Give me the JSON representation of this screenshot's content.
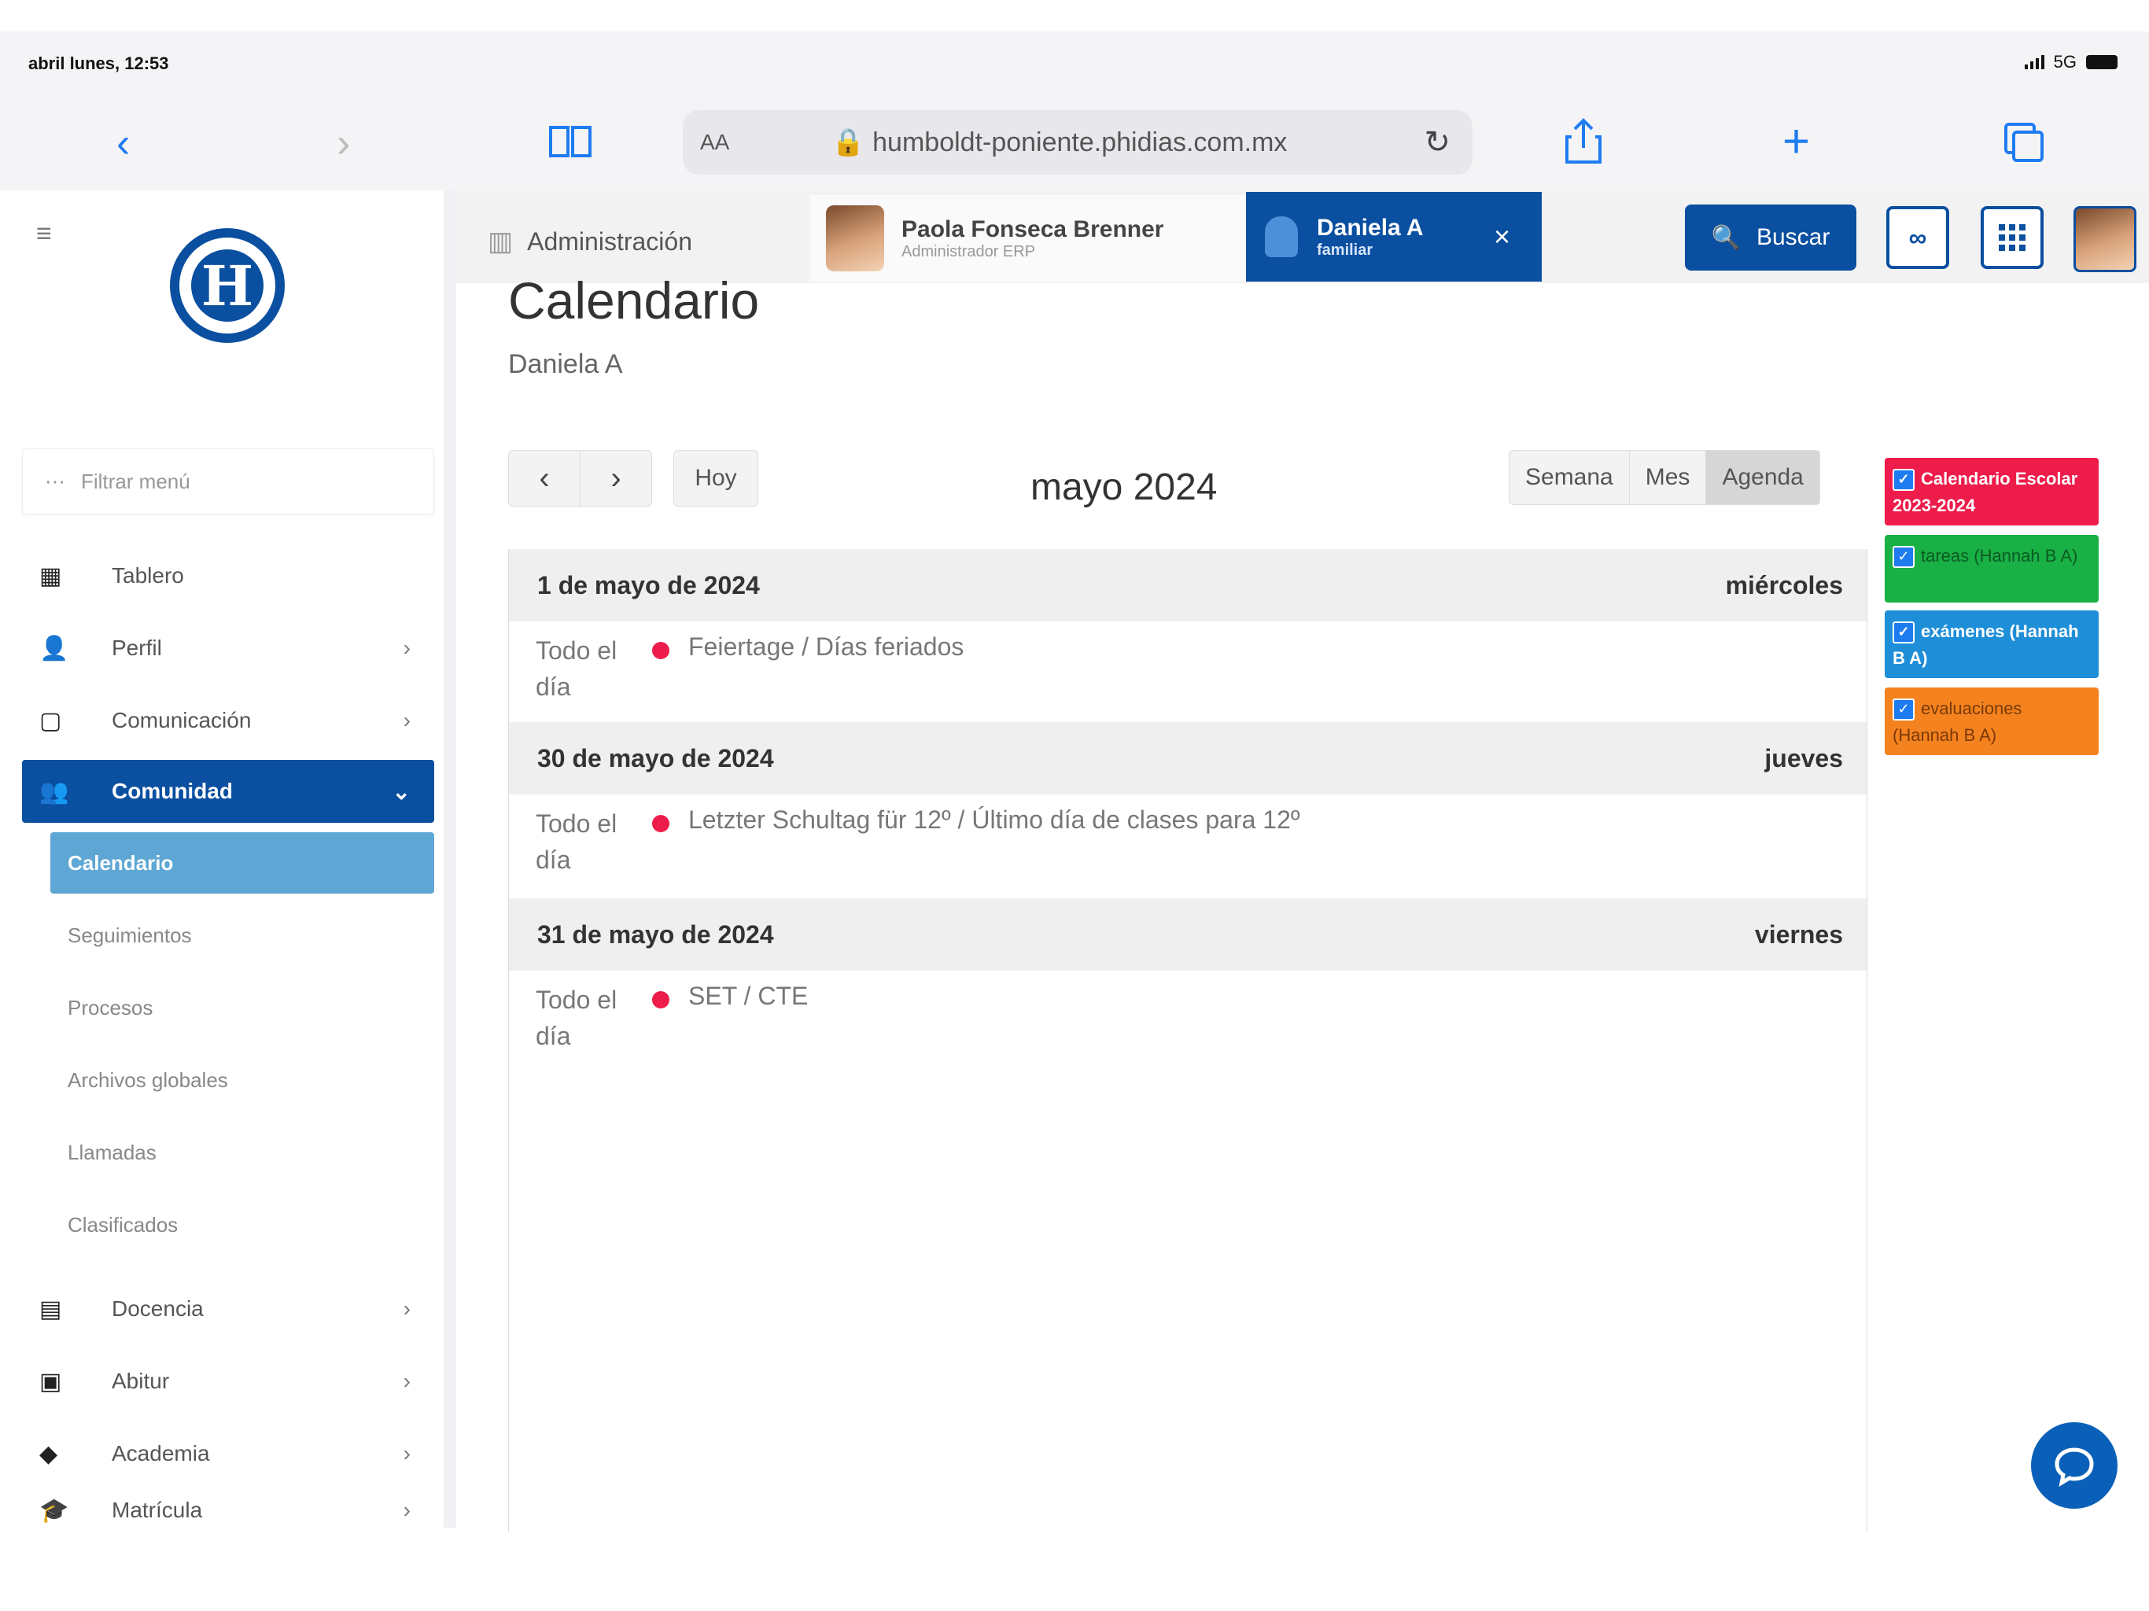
{
  "status_bar": {
    "time": "abril lunes, 12:53",
    "network": "5G"
  },
  "browser": {
    "aa_label": "AA",
    "url": "humboldt-poniente.phidias.com.mx",
    "back_icon": "chevron-left-icon",
    "forward_icon": "chevron-right-icon"
  },
  "header": {
    "admin_tab": "Administración",
    "user_tab": {
      "name": "Paola Fonseca Brenner",
      "role": "Administrador ERP"
    },
    "active_tab": {
      "name": "Daniela A",
      "role": "familiar"
    },
    "search_label": "Buscar"
  },
  "sidebar": {
    "filter_placeholder": "Filtrar menú",
    "items": [
      {
        "label": "Tablero",
        "icon": "dashboard-icon"
      },
      {
        "label": "Perfil",
        "icon": "user-icon"
      },
      {
        "label": "Comunicación",
        "icon": "chat-icon"
      },
      {
        "label": "Comunidad",
        "icon": "community-icon"
      },
      {
        "label": "Docencia",
        "icon": "teaching-icon"
      },
      {
        "label": "Abitur",
        "icon": "id-card-icon"
      },
      {
        "label": "Academia",
        "icon": "academy-icon"
      },
      {
        "label": "Matrícula",
        "icon": "graduation-cap-icon"
      }
    ],
    "subitems": [
      "Calendario",
      "Seguimientos",
      "Procesos",
      "Archivos globales",
      "Llamadas",
      "Clasificados"
    ]
  },
  "main": {
    "title": "Calendario",
    "subtitle": "Daniela A",
    "today_label": "Hoy",
    "month_label": "mayo 2024",
    "views": [
      "Semana",
      "Mes",
      "Agenda"
    ],
    "active_view": "Agenda",
    "days": [
      {
        "date": "1 de mayo de 2024",
        "weekday": "miércoles",
        "events": [
          {
            "time": "Todo el día",
            "title": "Feiertage / Días feriados"
          }
        ]
      },
      {
        "date": "30 de mayo de 2024",
        "weekday": "jueves",
        "events": [
          {
            "time": "Todo el día",
            "title": "Letzter Schultag für 12º / Último día de clases para 12º"
          }
        ]
      },
      {
        "date": "31 de mayo de 2024",
        "weekday": "viernes",
        "events": [
          {
            "time": "Todo el día",
            "title": "SET / CTE"
          }
        ]
      }
    ]
  },
  "calendars": [
    {
      "label": "Calendario Escolar 2023-2024",
      "color": "#ee1c4a"
    },
    {
      "label": "tareas (Hannah B A)",
      "color": "#19b045"
    },
    {
      "label": "exámenes (Hannah B A)",
      "color": "#1e8ed8"
    },
    {
      "label": "evaluaciones (Hannah B A)",
      "color": "#f4821f"
    }
  ],
  "colors": {
    "primary": "#0a4fa0",
    "active_sub": "#5ea6d4",
    "event_dot": "#ee1c4a"
  }
}
